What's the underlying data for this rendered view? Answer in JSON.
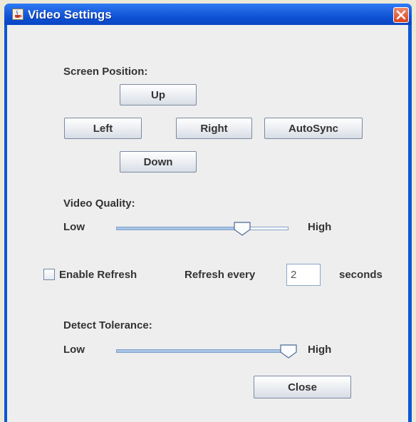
{
  "window": {
    "title": "Video Settings"
  },
  "screen_position": {
    "heading": "Screen Position:",
    "up_label": "Up",
    "left_label": "Left",
    "right_label": "Right",
    "autosync_label": "AutoSync",
    "down_label": "Down"
  },
  "video_quality": {
    "heading": "Video Quality:",
    "low_label": "Low",
    "high_label": "High",
    "level": 0.73
  },
  "refresh": {
    "enable_label": "Enable Refresh",
    "enabled": false,
    "every_label": "Refresh every",
    "interval_value": "2",
    "unit_label": "seconds"
  },
  "detect_tolerance": {
    "heading": "Detect Tolerance:",
    "low_label": "Low",
    "high_label": "High",
    "level": 1.0
  },
  "footer": {
    "close_label": "Close"
  },
  "colors": {
    "titlebar": "#0c4fd2",
    "close_button": "#d8431c",
    "client_bg": "#eeeeee"
  },
  "icons": {
    "app": "java-cup-icon",
    "close": "close-icon",
    "thumb": "slider-thumb-icon"
  }
}
